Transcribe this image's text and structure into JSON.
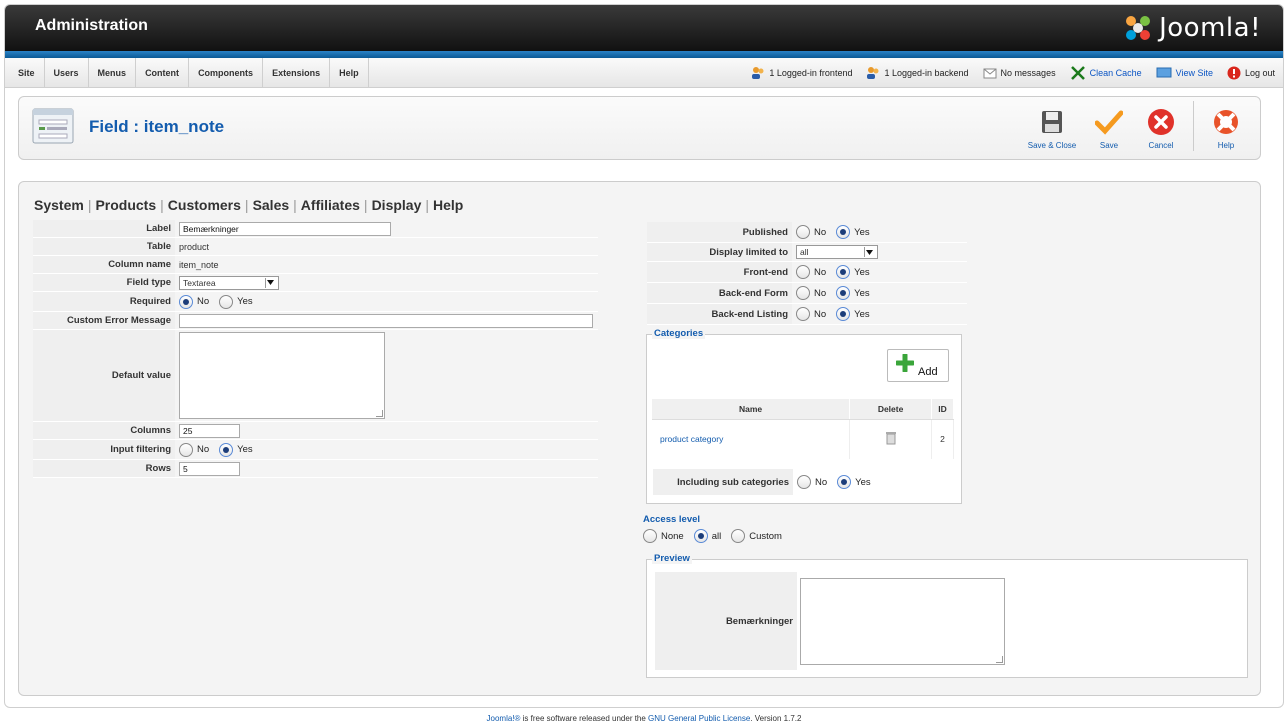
{
  "header": {
    "title": "Administration",
    "logo_text": "Joomla!"
  },
  "menu": [
    "Site",
    "Users",
    "Menus",
    "Content",
    "Components",
    "Extensions",
    "Help"
  ],
  "status": {
    "frontend": "1 Logged-in frontend",
    "backend": "1 Logged-in backend",
    "messages": "No messages",
    "clean_cache": "Clean Cache",
    "view_site": "View Site",
    "logout": "Log out"
  },
  "toolbar": {
    "page_title": "Field : item_note",
    "save_close": "Save & Close",
    "save": "Save",
    "cancel": "Cancel",
    "help": "Help"
  },
  "tabs": [
    "System",
    "Products",
    "Customers",
    "Sales",
    "Affiliates",
    "Display",
    "Help"
  ],
  "form": {
    "label_label": "Label",
    "label_value": "Bemærkninger",
    "table_label": "Table",
    "table_value": "product",
    "column_label": "Column name",
    "column_value": "item_note",
    "fieldtype_label": "Field type",
    "fieldtype_value": "Textarea",
    "required_label": "Required",
    "error_label": "Custom Error Message",
    "error_value": "",
    "default_label": "Default value",
    "columns_label": "Columns",
    "columns_value": "25",
    "filter_label": "Input filtering",
    "rows_label": "Rows",
    "rows_value": "5",
    "no": "No",
    "yes": "Yes"
  },
  "right": {
    "published_label": "Published",
    "limited_label": "Display limited to",
    "limited_value": "all",
    "frontend_label": "Front-end",
    "backend_form_label": "Back-end Form",
    "backend_listing_label": "Back-end Listing",
    "categories_legend": "Categories",
    "add_label": "Add",
    "col_name": "Name",
    "col_delete": "Delete",
    "col_id": "ID",
    "cat_name": "product category",
    "cat_id": "2",
    "include_sub_label": "Including sub categories"
  },
  "access": {
    "title": "Access level",
    "none": "None",
    "all": "all",
    "custom": "Custom"
  },
  "preview": {
    "legend": "Preview",
    "label": "Bemærkninger"
  },
  "footer": {
    "brand": "Joomla!®",
    "text": " is free software released under the ",
    "license": "GNU General Public License",
    "version": ".    Version 1.7.2"
  },
  "colors": {
    "accent": "#135cae",
    "blue_bar": "#1f73b6"
  }
}
